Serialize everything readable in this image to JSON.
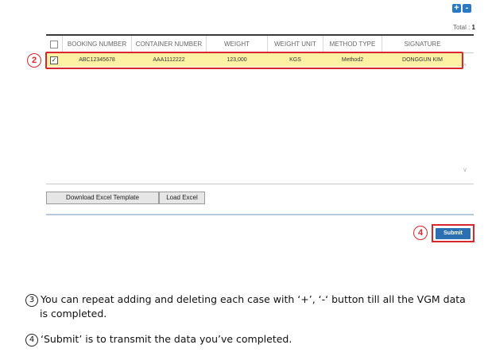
{
  "toolbar": {
    "add_label": "+",
    "delete_label": "-"
  },
  "total": {
    "label": "Total :",
    "count": "1"
  },
  "table": {
    "columns": [
      "BOOKING NUMBER",
      "CONTAINER NUMBER",
      "WEIGHT",
      "WEIGHT UNIT",
      "METHOD TYPE",
      "SIGNATURE"
    ],
    "rows": [
      {
        "checked": true,
        "booking_number": "ABC12345678",
        "container_number": "AAA1112222",
        "weight": "123,000",
        "weight_unit": "KGS",
        "method_type": "Method2",
        "signature": "DONGGUN KIM"
      }
    ]
  },
  "buttons": {
    "download_excel": "Download Excel Template",
    "load_excel": "Load Excel",
    "submit": "Submit"
  },
  "callouts": {
    "row_marker": "2",
    "submit_marker": "4"
  },
  "notes": [
    {
      "marker": "3",
      "line1": "You can repeat adding and deleting each case with ‘+’, ‘-‘ button till all the VGM data",
      "line2": "is completed."
    },
    {
      "marker": "4",
      "line1": "‘Submit’ is to transmit the data you’ve completed."
    }
  ],
  "colors": {
    "accent_blue": "#2c6fb3",
    "highlight_red": "#d9262c",
    "row_yellow": "#fdf2a3"
  }
}
